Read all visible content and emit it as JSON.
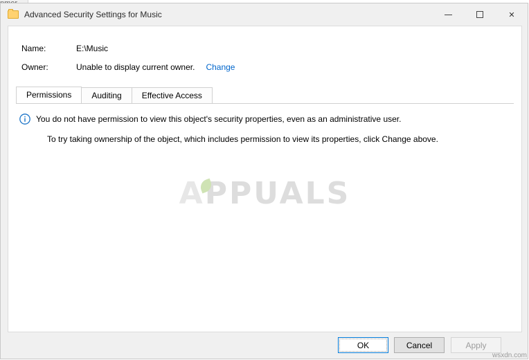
{
  "background": {
    "behind_window_label": "nmer"
  },
  "window": {
    "title": "Advanced Security Settings for Music",
    "icon": "folder-icon",
    "caption": {
      "minimize_label": "Minimize",
      "maximize_label": "Maximize",
      "close_label": "Close"
    }
  },
  "fields": {
    "name_label": "Name:",
    "name_value": "E:\\Music",
    "owner_label": "Owner:",
    "owner_value": "Unable to display current owner.",
    "owner_change_link": "Change"
  },
  "tabs": [
    {
      "label": "Permissions",
      "active": true
    },
    {
      "label": "Auditing",
      "active": false
    },
    {
      "label": "Effective Access",
      "active": false
    }
  ],
  "message": {
    "icon": "info-icon",
    "line1": "You do not have permission to view this object's security properties, even as an administrative user.",
    "line2": "To try taking ownership of the object, which includes permission to view its properties, click Change above."
  },
  "watermark": {
    "text_a": "A",
    "text_rest": "PPUALS"
  },
  "footer": {
    "ok_label": "OK",
    "cancel_label": "Cancel",
    "apply_label": "Apply"
  },
  "site_tag": "wsxdn.com",
  "colors": {
    "link": "#0066cc",
    "primary_border": "#0078d7",
    "info_icon": "#1a73c8",
    "folder": "#ffd271"
  }
}
